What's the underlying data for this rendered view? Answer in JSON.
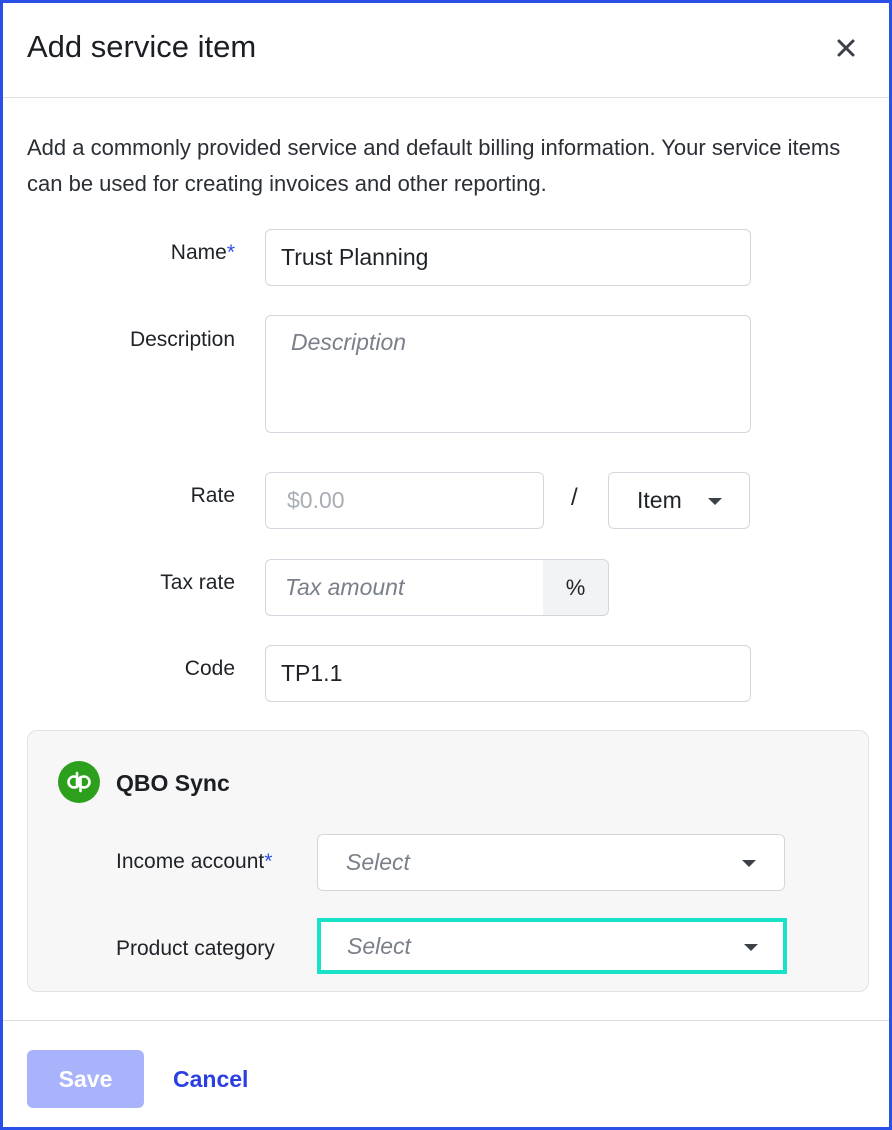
{
  "dialog": {
    "title": "Add service item",
    "intro": "Add a commonly provided service and default billing information. Your service items can be used for creating invoices and other reporting."
  },
  "form": {
    "name_label": "Name",
    "required_marker": "*",
    "name_value": "Trust Planning",
    "description_label": "Description",
    "description_placeholder": "Description",
    "rate_label": "Rate",
    "rate_placeholder": "$0.00",
    "rate_separator": "/",
    "unit_value": "Item",
    "tax_label": "Tax rate",
    "tax_placeholder": "Tax amount",
    "tax_suffix": "%",
    "code_label": "Code",
    "code_value": "TP1.1"
  },
  "qbo": {
    "title": "QBO Sync",
    "logo_text": "qb",
    "income_label": "Income account",
    "income_value": "Select",
    "category_label": "Product category",
    "category_value": "Select",
    "highlight_color": "#19e3c7"
  },
  "footer": {
    "save_label": "Save",
    "cancel_label": "Cancel"
  }
}
